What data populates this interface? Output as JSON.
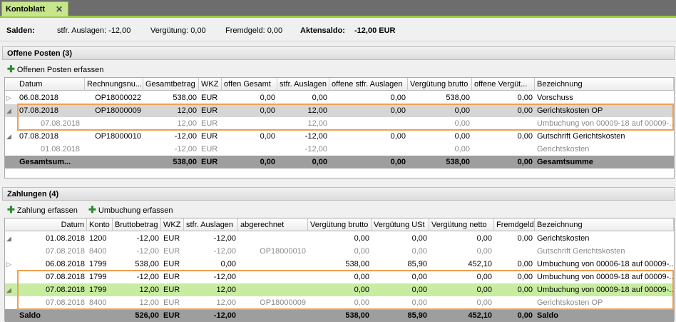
{
  "tab": {
    "title": "Kontoblatt",
    "close": "✕"
  },
  "salden": {
    "label": "Salden:",
    "stfr": "stfr. Auslagen: -12,00",
    "verg": "Vergütung:  0,00",
    "fremd": "Fremdgeld: 0,00",
    "akten_label": "Aktensaldo:",
    "akten_value": "-12,00 EUR"
  },
  "offene": {
    "title": "Offene Posten (3)",
    "add_label": "Offenen Posten erfassen",
    "headers": [
      "Datum",
      "Rechnungsnu...",
      "Gesamtbetrag",
      "WKZ",
      "offen Gesamt",
      "stfr. Auslagen",
      "offene stfr. Auslagen",
      "Vergütung brutto",
      "offene Vergüt...",
      "Bezeichnung"
    ],
    "rows": [
      [
        "06.08.2018",
        "OP18000022",
        "538,00",
        "EUR",
        "0,00",
        "0,00",
        "0,00",
        "538,00",
        "0,00",
        "Vorschuss"
      ],
      [
        "07.08.2018",
        "OP18000009",
        "12,00",
        "EUR",
        "0,00",
        "12,00",
        "0,00",
        "0,00",
        "0,00",
        "Gerichtskosten OP"
      ],
      [
        "07.08.2018",
        "",
        "12,00",
        "EUR",
        "",
        "12,00",
        "",
        "0,00",
        "",
        "Umbuchung von 00009-18 auf 00009-..."
      ],
      [
        "07.08.2018",
        "OP18000010",
        "-12,00",
        "EUR",
        "0,00",
        "-12,00",
        "0,00",
        "0,00",
        "0,00",
        "Gutschrift Gerichtskosten"
      ],
      [
        "01.08.2018",
        "",
        "-12,00",
        "EUR",
        "",
        "-12,00",
        "",
        "0,00",
        "",
        "Gerichtskosten"
      ]
    ],
    "sum": [
      "Gesamtsum...",
      "",
      "538,00",
      "EUR",
      "0,00",
      "0,00",
      "0,00",
      "538,00",
      "0,00",
      "Gesamtsumme"
    ]
  },
  "zahlungen": {
    "title": "Zahlungen (4)",
    "add_label": "Zahlung erfassen",
    "umbuchung_label": "Umbuchung erfassen",
    "headers": [
      "Datum",
      "Konto",
      "Bruttobetrag",
      "WKZ",
      "stfr. Auslagen",
      "abgerechnet",
      "Vergütung brutto",
      "Vergütung USt",
      "Vergütung netto",
      "Fremdgeld",
      "Bezeichnung"
    ],
    "rows": [
      [
        "01.08.2018",
        "1200",
        "-12,00",
        "EUR",
        "-12,00",
        "",
        "0,00",
        "0,00",
        "0,00",
        "0,00",
        "Gerichtskosten"
      ],
      [
        "07.08.2018",
        "8400",
        "-12,00",
        "EUR",
        "-12,00",
        "OP18000010",
        "0,00",
        "0,00",
        "0,00",
        "",
        "Gutschrift Gerichtskosten"
      ],
      [
        "06.08.2018",
        "1799",
        "538,00",
        "EUR",
        "0,00",
        "",
        "538,00",
        "85,90",
        "452,10",
        "0,00",
        "Umbuchung von 00006-18 auf 00009-..."
      ],
      [
        "07.08.2018",
        "1799",
        "-12,00",
        "EUR",
        "-12,00",
        "",
        "0,00",
        "0,00",
        "0,00",
        "0,00",
        "Umbuchung von 00009-18 auf 00009-..."
      ],
      [
        "07.08.2018",
        "1799",
        "12,00",
        "EUR",
        "12,00",
        "",
        "0,00",
        "0,00",
        "0,00",
        "0,00",
        "Umbuchung von 00009-18 auf 00009-..."
      ],
      [
        "07.08.2018",
        "8400",
        "12,00",
        "EUR",
        "12,00",
        "OP18000009",
        "0,00",
        "0,00",
        "0,00",
        "",
        "Gerichtskosten OP"
      ]
    ],
    "sum": [
      "Saldo",
      "",
      "526,00",
      "EUR",
      "-12,00",
      "",
      "538,00",
      "85,90",
      "452,10",
      "0,00",
      "Saldo"
    ]
  },
  "colors": {
    "accent": "#9acd3c",
    "highlight": "#f0a050",
    "selected_green": "#c8eca0"
  }
}
